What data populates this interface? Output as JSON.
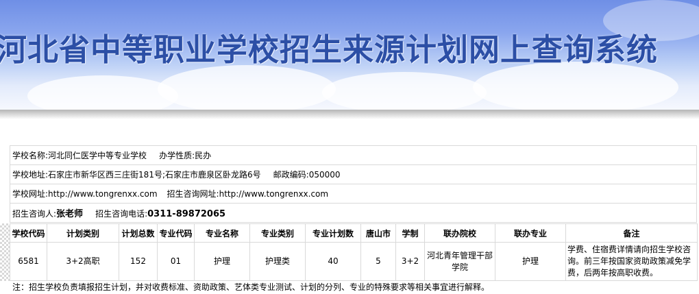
{
  "banner": {
    "title": "河北省中等职业学校招生来源计划网上查询系统"
  },
  "school": {
    "name_label": "学校名称:",
    "name": "河北同仁医学中等专业学校",
    "nature_label": "办学性质:",
    "nature": "民办",
    "address_label": "学校地址:",
    "address": "石家庄市新华区西三庄街181号;石家庄市鹿泉区卧龙路6号",
    "postcode_label": "邮政编码:",
    "postcode": "050000",
    "website_label": "学校网址:",
    "website": "http://www.tongrenxx.com",
    "enroll_site_label": "招生咨询网址:",
    "enroll_site": "http://www.tongrenxx.com",
    "contact_label": "招生咨询人:",
    "contact": "张老师",
    "phone_label": "招生咨询电话:",
    "phone_prefix": "0311-",
    "phone_number": "89872065"
  },
  "plan_table": {
    "headers": [
      "学校代码",
      "计划类别",
      "计划总数",
      "专业代码",
      "专业名称",
      "专业类别",
      "专业计划数",
      "唐山市",
      "学制",
      "联办院校",
      "联办专业",
      "备注"
    ],
    "rows": [
      [
        "6581",
        "3+2高职",
        "152",
        "01",
        "护理",
        "护理类",
        "40",
        "5",
        "3+2",
        "河北青年管理干部学院",
        "护理",
        "学费、住宿费详情请向招生学校咨询。前三年按国家资助政策减免学费，后两年按高职收费。"
      ]
    ]
  },
  "note": "注：招生学校负责填报招生计划，并对收费标准、资助政策、艺体类专业测试、计划的分列、专业的特殊要求等相关事宜进行解释。"
}
